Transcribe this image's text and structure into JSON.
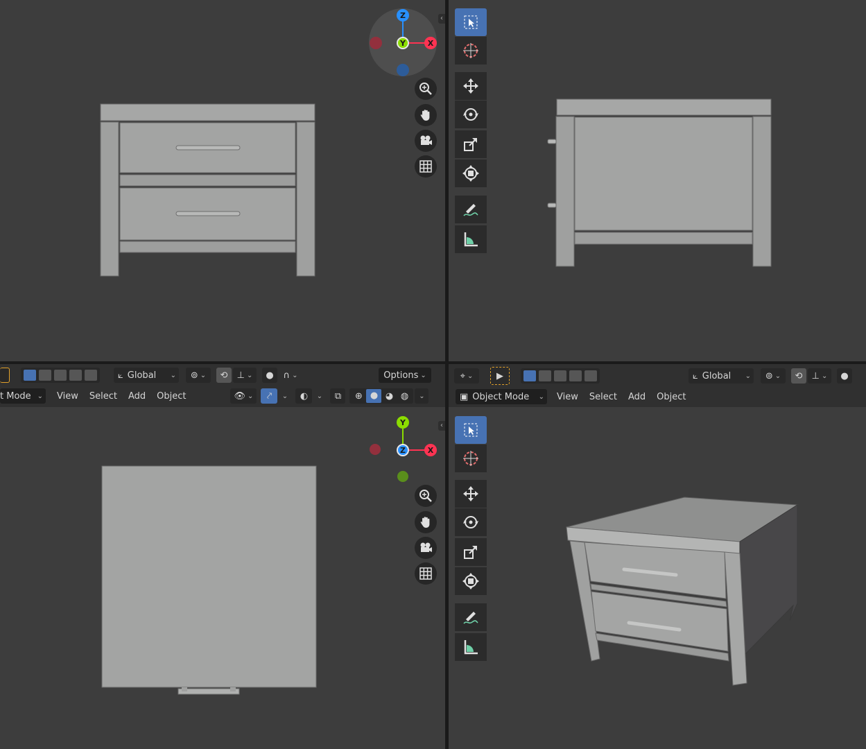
{
  "colors": {
    "select_accent": "#4772b3",
    "axis_x": "#ff3352",
    "axis_y": "#8bdc00",
    "axis_z": "#2890ff",
    "viewport_bg": "#3d3d3d",
    "header_bg": "#303030",
    "model": "#a5a6a5"
  },
  "bottom_left_header": {
    "transform_orientation": "Global",
    "options_label": "Options",
    "mode_label": "t Mode",
    "menu": {
      "view": "View",
      "select": "Select",
      "add": "Add",
      "object": "Object"
    }
  },
  "bottom_right_header": {
    "transform_orientation": "Global",
    "mode_label": "Object Mode",
    "menu": {
      "view": "View",
      "select": "Select",
      "add": "Add",
      "object": "Object"
    }
  },
  "gizmo_top_left": {
    "z": "Z",
    "y": "Y",
    "x": "X"
  },
  "gizmo_bottom_left": {
    "y": "Y",
    "z": "Z",
    "x": "X"
  },
  "toolbar_icons": [
    "select-box-icon",
    "cursor-icon",
    "move-icon",
    "rotate-icon",
    "scale-icon",
    "transform-icon",
    "annotate-icon",
    "measure-icon"
  ],
  "nav_icons": [
    "zoom-icon",
    "pan-hand-icon",
    "camera-icon",
    "ortho-grid-icon"
  ]
}
